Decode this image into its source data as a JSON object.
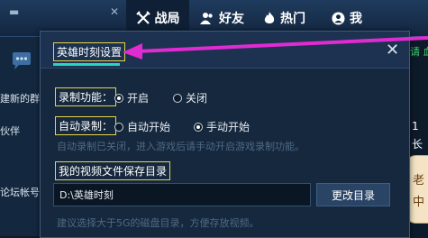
{
  "topbar": {
    "tabs": [
      {
        "label": "战局",
        "icon": "battle-icon"
      },
      {
        "label": "好友",
        "icon": "friends-icon"
      },
      {
        "label": "热门",
        "icon": "flame-icon"
      },
      {
        "label": "我",
        "icon": "user-icon"
      }
    ]
  },
  "sidebar": {
    "items": [
      "建新的群",
      "伙伴",
      "论坛帐号"
    ]
  },
  "rightstrip": {
    "top_text": "请 血",
    "mid_text": "1",
    "mid_text2": "长",
    "mascot_text_1": "老",
    "mascot_text_2": "中"
  },
  "dialog": {
    "title": "英雄时刻设置",
    "record_function": {
      "label": "录制功能：",
      "options": [
        "开启",
        "关闭"
      ],
      "selected": "开启"
    },
    "auto_record": {
      "label": "自动录制：",
      "options": [
        "自动开始",
        "手动开始"
      ],
      "selected": "手动开始",
      "hint": "自动录制已关闭，进入游戏后请手动开启游戏录制功能。"
    },
    "save_dir": {
      "label": "我的视频文件保存目录",
      "value": "D:\\英雄时刻",
      "button": "更改目录",
      "hint": "建议选择大于5G的磁盘目录，方便存放视频。"
    }
  },
  "colors": {
    "annotation": "#e12bd2",
    "highlight_box": "#e6d44a",
    "accent_underline": "#29d4c0"
  }
}
